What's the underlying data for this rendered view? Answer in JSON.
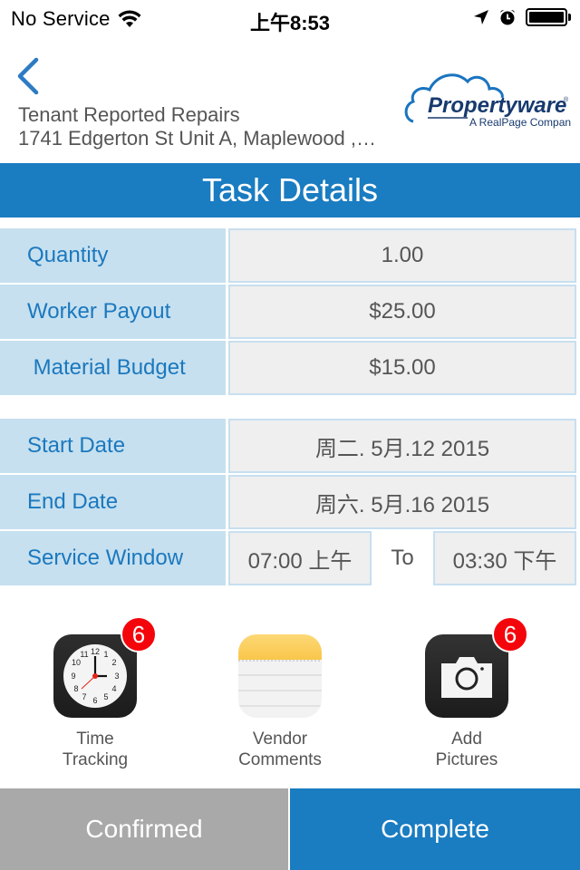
{
  "status_bar": {
    "carrier": "No Service",
    "time": "上午8:53",
    "battery_level": 1.0,
    "icons": [
      "wifi-icon",
      "location-arrow-icon",
      "alarm-clock-icon",
      "battery-icon"
    ]
  },
  "header": {
    "back_icon": "chevron-left-icon",
    "title": "Tenant Reported Repairs",
    "address": "1741 Edgerton St Unit A, Maplewood ,…",
    "logo": {
      "brand": "Propertyware",
      "registered_mark": "®",
      "tagline": "A RealPage Company"
    }
  },
  "page_title": "Task Details",
  "details_group_1": [
    {
      "label": "Quantity",
      "value": "1.00"
    },
    {
      "label": "Worker Payout",
      "value": "$25.00"
    },
    {
      "label": " Material Budget",
      "value": "$15.00"
    }
  ],
  "details_group_2": [
    {
      "label": "Start Date",
      "value": "周二. 5月.12 2015"
    },
    {
      "label": "End Date",
      "value": "周六. 5月.16 2015"
    }
  ],
  "service_window": {
    "label": "Service Window",
    "start": "07:00 上午",
    "separator": "To",
    "end": "03:30 下午"
  },
  "actions": [
    {
      "name": "time-tracking",
      "icon": "clock-icon",
      "line1": "Time",
      "line2": "Tracking",
      "badge": "6"
    },
    {
      "name": "vendor-comments",
      "icon": "notes-icon",
      "line1": "Vendor",
      "line2": "Comments",
      "badge": null
    },
    {
      "name": "add-pictures",
      "icon": "camera-icon",
      "line1": "Add",
      "line2": "Pictures",
      "badge": "6"
    }
  ],
  "buttons": {
    "confirmed": "Confirmed",
    "complete": "Complete"
  },
  "colors": {
    "accent": "#1a7cc1",
    "label_bg": "#c6e0ef",
    "label_text": "#1b78be",
    "value_bg": "#efefef",
    "value_border": "#c7dff0",
    "badge": "#f4050b",
    "confirmed_bg": "#a9a9a9"
  }
}
